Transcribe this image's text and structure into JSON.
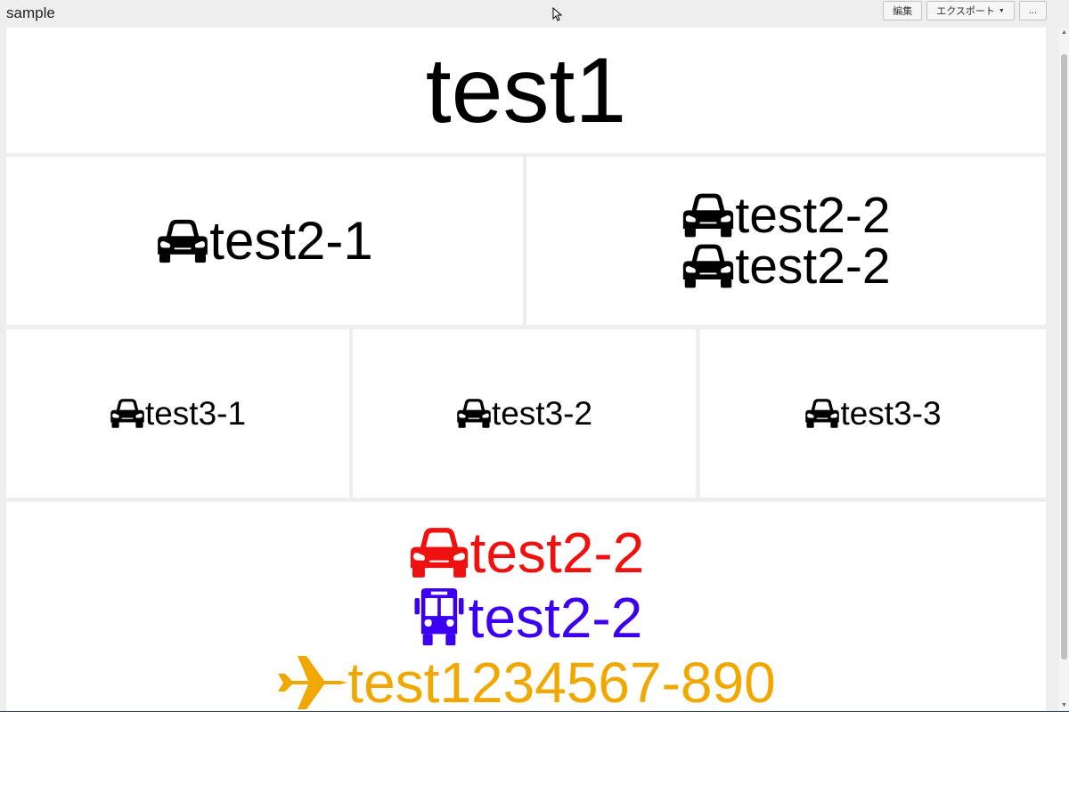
{
  "dashboard": {
    "title": "sample"
  },
  "toolbar": {
    "edit_label": "編集",
    "export_label": "エクスポート",
    "more_label": "..."
  },
  "colors": {
    "red": "#ef1010",
    "blue": "#3b00f0",
    "orange": "#f0a800",
    "black": "#000000"
  },
  "panels": {
    "p1": {
      "text": "test1"
    },
    "p2_1": {
      "icon": "car-icon",
      "text": "test2-1"
    },
    "p2_2": {
      "lines": [
        {
          "icon": "car-icon",
          "text": "test2-2"
        },
        {
          "icon": "car-icon",
          "text": "test2-2"
        }
      ]
    },
    "p3_1": {
      "icon": "car-icon",
      "text": "test3-1"
    },
    "p3_2": {
      "icon": "car-icon",
      "text": "test3-2"
    },
    "p3_3": {
      "icon": "car-icon",
      "text": "test3-3"
    },
    "p4": {
      "lines": [
        {
          "icon": "car-icon",
          "text": "test2-2",
          "color": "red"
        },
        {
          "icon": "bus-icon",
          "text": "test2-2",
          "color": "blue"
        },
        {
          "icon": "airplane-icon",
          "text": "test1234567-890",
          "color": "orange"
        }
      ]
    }
  }
}
